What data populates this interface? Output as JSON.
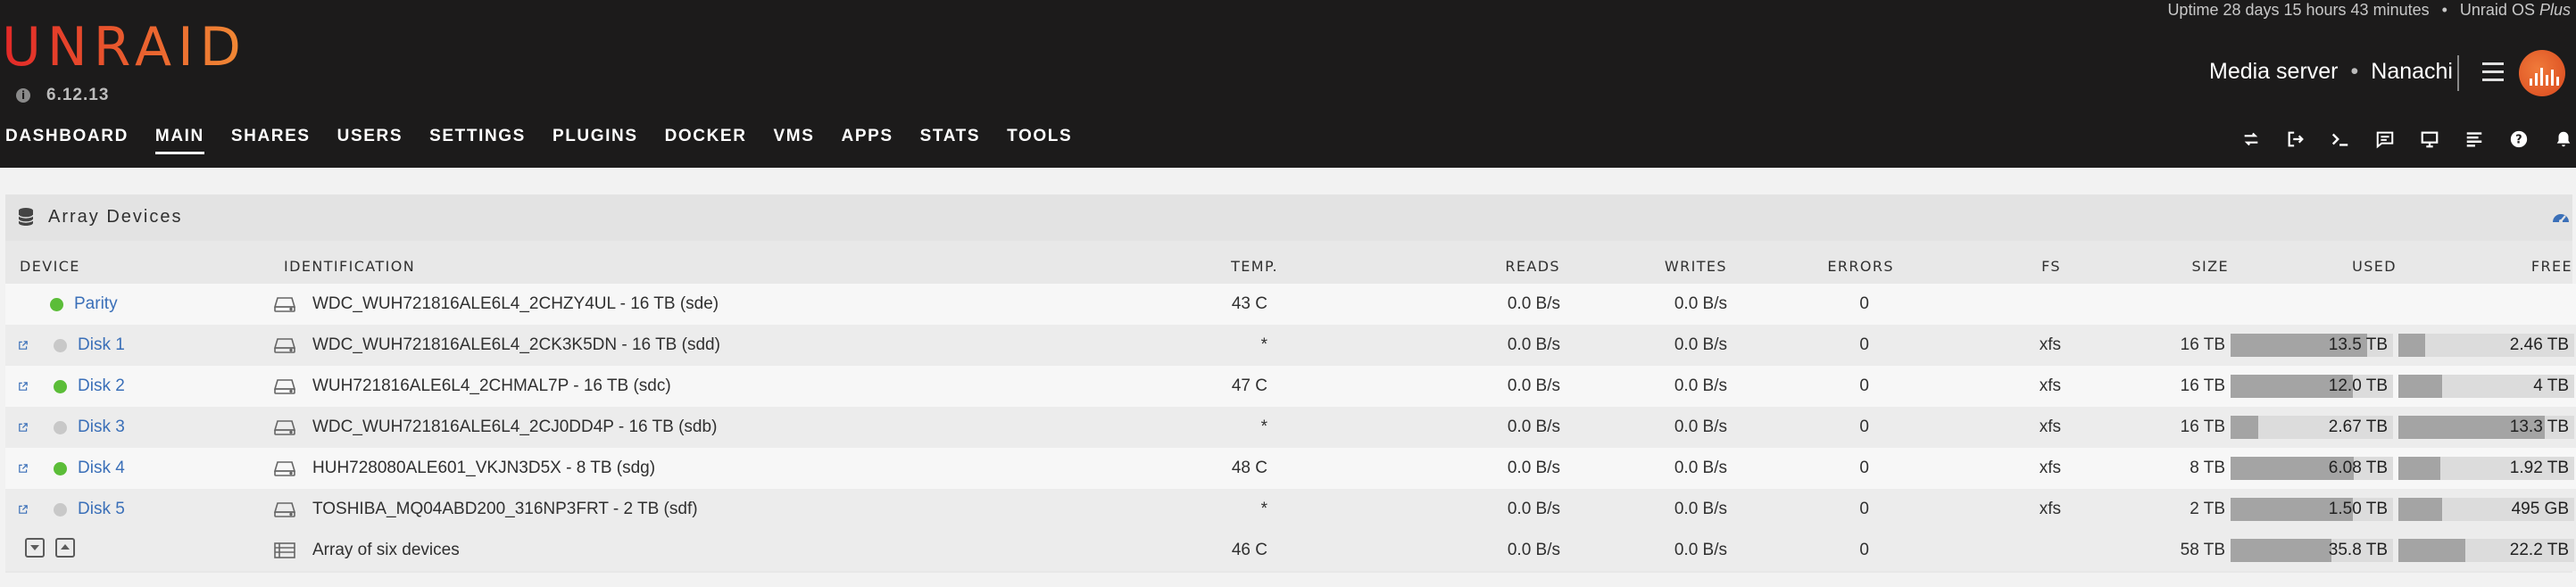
{
  "brand": {
    "logo_text": "UNRAID",
    "version": "6.12.13"
  },
  "status": {
    "uptime": "Uptime 28 days 15 hours 43 minutes",
    "separator": "•",
    "os_prefix": "Unraid OS",
    "os_edition": "Plus"
  },
  "server": {
    "description": "Media server",
    "separator": "•",
    "name": "Nanachi"
  },
  "nav": [
    {
      "label": "DASHBOARD",
      "active": false
    },
    {
      "label": "MAIN",
      "active": true
    },
    {
      "label": "SHARES",
      "active": false
    },
    {
      "label": "USERS",
      "active": false
    },
    {
      "label": "SETTINGS",
      "active": false
    },
    {
      "label": "PLUGINS",
      "active": false
    },
    {
      "label": "DOCKER",
      "active": false
    },
    {
      "label": "VMS",
      "active": false
    },
    {
      "label": "APPS",
      "active": false
    },
    {
      "label": "STATS",
      "active": false
    },
    {
      "label": "TOOLS",
      "active": false
    }
  ],
  "toolbar_icons": [
    "refresh-icon",
    "logout-icon",
    "terminal-icon",
    "feedback-icon",
    "monitor-icon",
    "log-icon",
    "help-icon",
    "bell-icon"
  ],
  "panel": {
    "title": "Array Devices"
  },
  "columns": [
    "DEVICE",
    "IDENTIFICATION",
    "TEMP.",
    "READS",
    "WRITES",
    "ERRORS",
    "FS",
    "SIZE",
    "USED",
    "FREE"
  ],
  "colors": {
    "status_green": "#5bbd38",
    "status_gray": "#c8c8c8",
    "link_blue": "#3a6fb8",
    "accent_orange": "#e8562d"
  },
  "devices": [
    {
      "device": "Parity",
      "status": "green",
      "link": false,
      "identification": "WDC_WUH721816ALE6L4_2CHZY4UL - 16 TB (sde)",
      "temp": "43 C",
      "reads": "0.0 B/s",
      "writes": "0.0 B/s",
      "errors": "0",
      "fs": "",
      "size": "",
      "used": "",
      "free": "",
      "used_pct": 0,
      "free_pct": 0
    },
    {
      "device": "Disk 1",
      "status": "gray",
      "link": true,
      "identification": "WDC_WUH721816ALE6L4_2CK3K5DN - 16 TB (sdd)",
      "temp": "*",
      "reads": "0.0 B/s",
      "writes": "0.0 B/s",
      "errors": "0",
      "fs": "xfs",
      "size": "16 TB",
      "used": "13.5 TB",
      "free": "2.46 TB",
      "used_pct": 84,
      "free_pct": 15
    },
    {
      "device": "Disk 2",
      "status": "green",
      "link": true,
      "identification": "WUH721816ALE6L4_2CHMAL7P - 16 TB (sdc)",
      "temp": "47 C",
      "reads": "0.0 B/s",
      "writes": "0.0 B/s",
      "errors": "0",
      "fs": "xfs",
      "size": "16 TB",
      "used": "12.0 TB",
      "free": "4 TB",
      "used_pct": 75,
      "free_pct": 25
    },
    {
      "device": "Disk 3",
      "status": "gray",
      "link": true,
      "identification": "WDC_WUH721816ALE6L4_2CJ0DD4P - 16 TB (sdb)",
      "temp": "*",
      "reads": "0.0 B/s",
      "writes": "0.0 B/s",
      "errors": "0",
      "fs": "xfs",
      "size": "16 TB",
      "used": "2.67 TB",
      "free": "13.3 TB",
      "used_pct": 17,
      "free_pct": 83
    },
    {
      "device": "Disk 4",
      "status": "green",
      "link": true,
      "identification": "HUH728080ALE601_VKJN3D5X - 8 TB (sdg)",
      "temp": "48 C",
      "reads": "0.0 B/s",
      "writes": "0.0 B/s",
      "errors": "0",
      "fs": "xfs",
      "size": "8 TB",
      "used": "6.08 TB",
      "free": "1.92 TB",
      "used_pct": 76,
      "free_pct": 24
    },
    {
      "device": "Disk 5",
      "status": "gray",
      "link": true,
      "identification": "TOSHIBA_MQ04ABD200_316NP3FRT - 2 TB (sdf)",
      "temp": "*",
      "reads": "0.0 B/s",
      "writes": "0.0 B/s",
      "errors": "0",
      "fs": "xfs",
      "size": "2 TB",
      "used": "1.50 TB",
      "free": "495 GB",
      "used_pct": 75,
      "free_pct": 25
    }
  ],
  "summary": {
    "identification": "Array of six devices",
    "temp": "46 C",
    "reads": "0.0 B/s",
    "writes": "0.0 B/s",
    "errors": "0",
    "size": "58 TB",
    "used": "35.8 TB",
    "free": "22.2 TB",
    "used_pct": 62,
    "free_pct": 38
  }
}
